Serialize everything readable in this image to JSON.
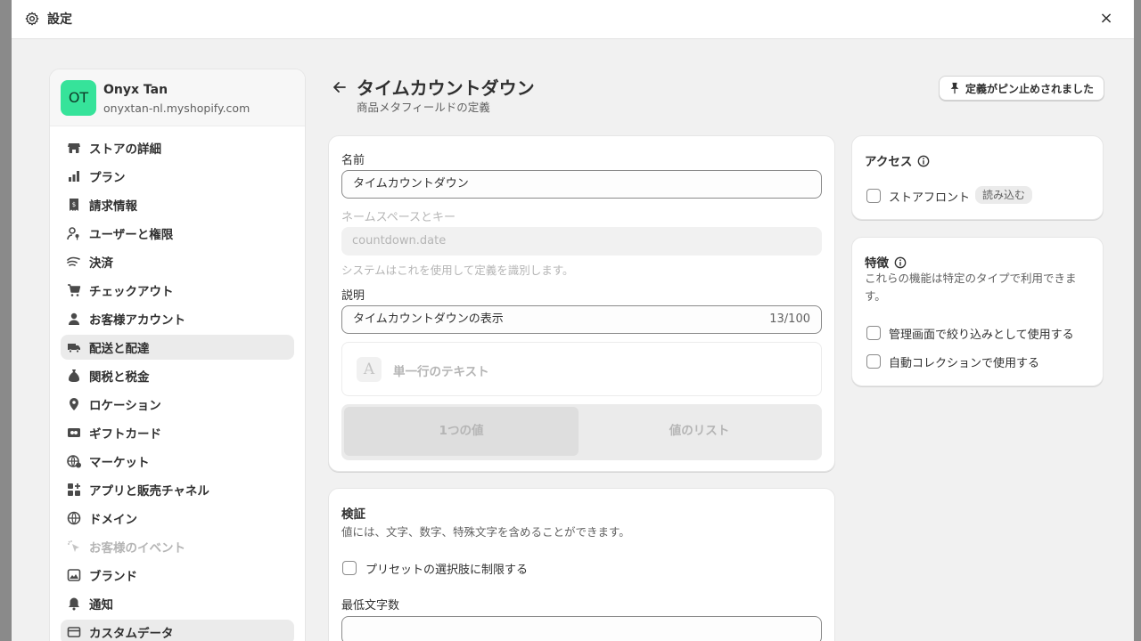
{
  "window": {
    "title": "設定",
    "close_label": "×"
  },
  "store": {
    "initials": "OT",
    "name": "Onyx Tan",
    "domain": "onyxtan-nl.myshopify.com",
    "avatar_color": "#36e39a"
  },
  "sidebar": {
    "items": [
      {
        "label": "ストアの詳細",
        "icon": "store-icon"
      },
      {
        "label": "プラン",
        "icon": "plan-icon"
      },
      {
        "label": "請求情報",
        "icon": "receipt-icon"
      },
      {
        "label": "ユーザーと権限",
        "icon": "user-key-icon"
      },
      {
        "label": "決済",
        "icon": "payment-icon"
      },
      {
        "label": "チェックアウト",
        "icon": "cart-icon"
      },
      {
        "label": "お客様アカウント",
        "icon": "person-icon"
      },
      {
        "label": "配送と配達",
        "icon": "truck-icon",
        "active": true
      },
      {
        "label": "関税と税金",
        "icon": "money-bag-icon"
      },
      {
        "label": "ロケーション",
        "icon": "location-pin-icon"
      },
      {
        "label": "ギフトカード",
        "icon": "gift-card-icon"
      },
      {
        "label": "マーケット",
        "icon": "globe-dollar-icon"
      },
      {
        "label": "アプリと販売チャネル",
        "icon": "apps-icon"
      },
      {
        "label": "ドメイン",
        "icon": "globe-icon"
      },
      {
        "label": "お客様のイベント",
        "icon": "cursor-click-icon",
        "disabled": true
      },
      {
        "label": "ブランド",
        "icon": "brand-icon"
      },
      {
        "label": "通知",
        "icon": "bell-icon"
      },
      {
        "label": "カスタムデータ",
        "icon": "database-icon",
        "active": true
      }
    ]
  },
  "header": {
    "title": "タイムカウントダウン",
    "subtitle": "商品メタフィールドの定義",
    "pin_button": "定義がピン止めされました"
  },
  "definition": {
    "name_label": "名前",
    "name_value": "タイムカウントダウン",
    "namespace_label": "ネームスペースとキー",
    "namespace_value": "countdown.date",
    "namespace_help": "システムはこれを使用して定義を識別します。",
    "description_label": "説明",
    "description_value": "タイムカウントダウンの表示",
    "description_counter": "13/100",
    "type_icon": "A",
    "type_label": "単一行のテキスト",
    "value_options": [
      "1つの値",
      "値のリスト"
    ],
    "selected_option": 0
  },
  "validation": {
    "title": "検証",
    "description": "値には、文字、数字、特殊文字を含めることができます。",
    "preset_label": "プリセットの選択肢に制限する",
    "min_chars_label": "最低文字数"
  },
  "access": {
    "title": "アクセス",
    "storefront_label": "ストアフロント",
    "storefront_badge": "読み込む"
  },
  "features": {
    "title": "特徴",
    "description": "これらの機能は特定のタイプで利用できます。",
    "options": [
      "管理画面で絞り込みとして使用する",
      "自動コレクションで使用する"
    ]
  }
}
